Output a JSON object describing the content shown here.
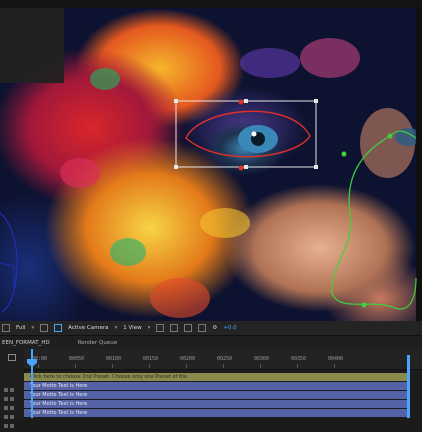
{
  "viewer_bar": {
    "zoom": "Full",
    "camera": "Active Camera",
    "view": "1 View",
    "offset": "+0.0"
  },
  "tabs": {
    "composition": "EEN_FORMAT_HD",
    "render_queue": "Render Queue"
  },
  "timeline": {
    "ticks": [
      "00:00",
      "00050",
      "00100",
      "00150",
      "00200",
      "00250",
      "00300",
      "00350",
      "00400"
    ],
    "layers": [
      {
        "label": "Click here to choose 2nd Preset. Choose only one Preset of the",
        "kind": "guide"
      },
      {
        "label": "Your Motto Text is Here",
        "kind": "text"
      },
      {
        "label": "Your Motto Text is Here",
        "kind": "text"
      },
      {
        "label": "Your Motto Text is Here",
        "kind": "text"
      },
      {
        "label": "Your Motto Text is Here",
        "kind": "text"
      }
    ]
  },
  "colors": {
    "accent": "#4aa3ff",
    "guide_layer": "#8a8a4c",
    "text_layer": "#5562a6",
    "mask_path": "#e0302a",
    "spline_path": "#3ed23e"
  }
}
